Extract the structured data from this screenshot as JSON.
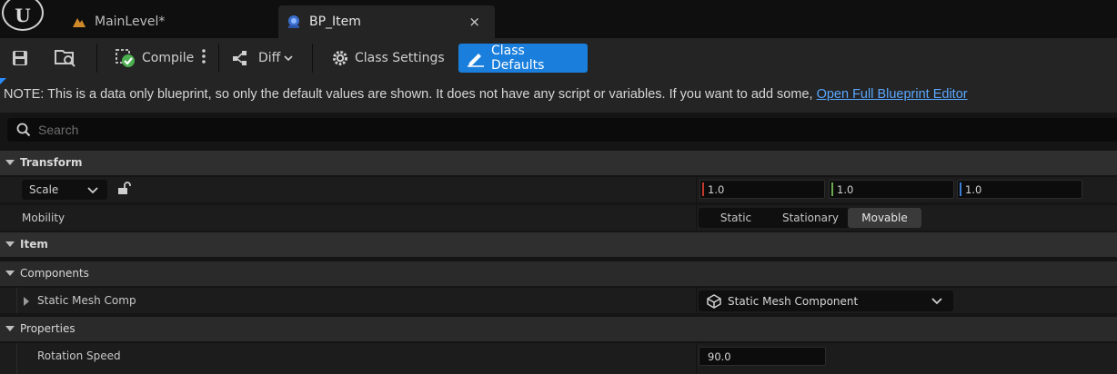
{
  "tabs": [
    {
      "label": "MainLevel*",
      "icon": "level-icon",
      "active": false
    },
    {
      "label": "BP_Item",
      "icon": "blueprint-icon",
      "active": true,
      "close": "×"
    }
  ],
  "toolbar": {
    "save_icon": "save-icon",
    "browse_icon": "browse-icon",
    "compile_label": "Compile",
    "diff_label": "Diff",
    "class_settings_label": "Class Settings",
    "class_defaults_label": "Class Defaults"
  },
  "note": {
    "text": "NOTE: This is a data only blueprint, so only the default values are shown.  It does not have any script or variables.  If you want to add some, ",
    "link": "Open Full Blueprint Editor"
  },
  "search": {
    "placeholder": "Search"
  },
  "details": {
    "transform": {
      "label": "Transform",
      "scale_mode": "Scale",
      "scale": {
        "x": "1.0",
        "y": "1.0",
        "z": "1.0"
      },
      "mobility_label": "Mobility",
      "mobility_options": [
        "Static",
        "Stationary",
        "Movable"
      ],
      "mobility_selected": "Movable"
    },
    "item": {
      "label": "Item"
    },
    "components": {
      "label": "Components",
      "static_mesh_label": "Static Mesh Comp",
      "static_mesh_value": "Static Mesh Component"
    },
    "properties": {
      "label": "Properties",
      "rotation_speed_label": "Rotation Speed",
      "rotation_speed_value": "90.0"
    }
  },
  "colors": {
    "accent": "#1a7fdc",
    "x_axis": "#c0392b",
    "y_axis": "#6aa84f",
    "z_axis": "#3b7fd4",
    "link": "#5aa7ff"
  }
}
